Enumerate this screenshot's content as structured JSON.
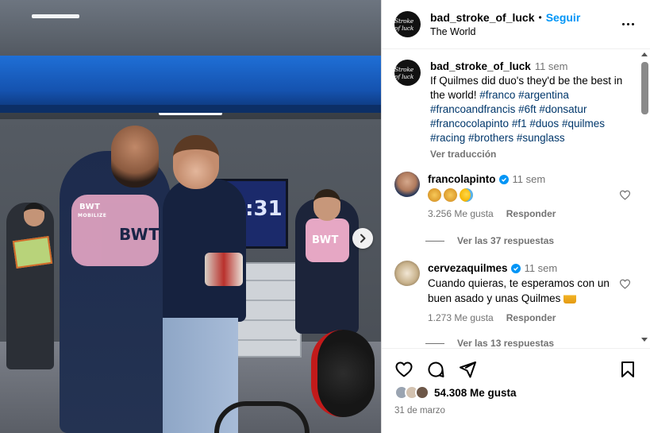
{
  "post": {
    "username": "bad_stroke_of_luck",
    "follow_label": "Seguir",
    "location": "The World",
    "separator": "•",
    "avatar_text": "Stroke of luck"
  },
  "photo": {
    "screen_text": "3:31",
    "shirt_text_1": "BWT",
    "shirt_text_2": "MOBILIZE",
    "shirt_text_3": "BWT",
    "shirt_text_4": "BWT"
  },
  "caption": {
    "username": "bad_stroke_of_luck",
    "time": "11 sem",
    "text": "If Quilmes did duo's they'd be the best in the world!",
    "hashtags": [
      "#franco",
      "#argentina",
      "#francoandfrancis",
      "#6ft",
      "#donsatur",
      "#francocolapinto",
      "#f1",
      "#duos",
      "#quilmes",
      "#racing",
      "#brothers",
      "#sunglass"
    ],
    "translate_label": "Ver traducción"
  },
  "comments": [
    {
      "username": "francolapinto",
      "time": "11 sem",
      "text": "",
      "emojis": [
        "clapping-hands",
        "clapping-hands",
        "crying-laughing"
      ],
      "likes": "3.256 Me gusta",
      "reply_label": "Responder",
      "replies_label": "Ver las 37 respuestas"
    },
    {
      "username": "cervezaquilmes",
      "time": "11 sem",
      "text": "Cuando quieras, te esperamos con un buen asado y unas Quilmes 🍻",
      "text_plain": "Cuando quieras, te esperamos con un buen asado y unas Quilmes",
      "likes": "1.273 Me gusta",
      "reply_label": "Responder",
      "replies_label": "Ver las 13 respuestas"
    }
  ],
  "footer": {
    "likes": "54.308 Me gusta",
    "date": "31 de marzo"
  },
  "colors": {
    "accent": "#0095f6",
    "hashtag": "#00376b",
    "muted": "#737373"
  }
}
